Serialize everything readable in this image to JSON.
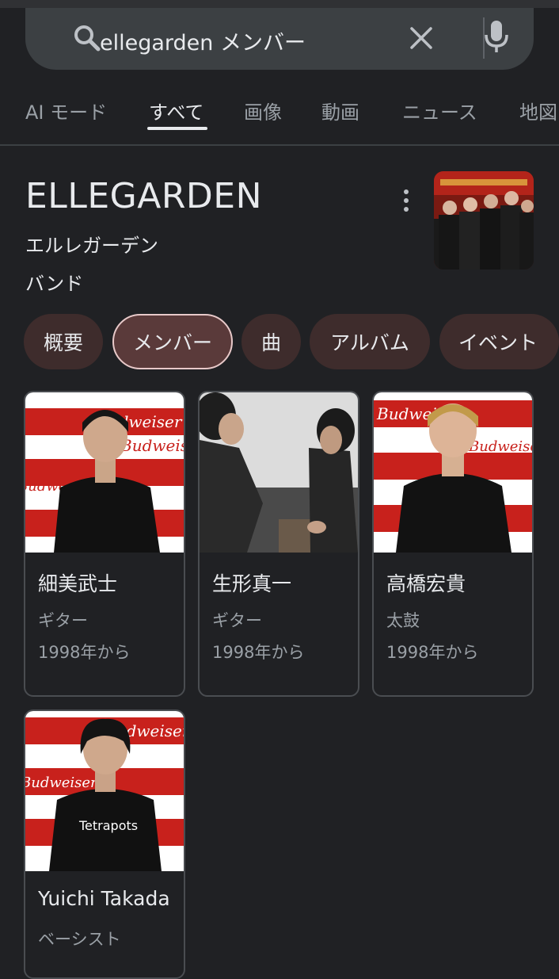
{
  "search": {
    "query": "ellegarden メンバー"
  },
  "tabs": [
    {
      "label": "AI モード"
    },
    {
      "label": "すべて"
    },
    {
      "label": "画像"
    },
    {
      "label": "動画"
    },
    {
      "label": "ニュース"
    },
    {
      "label": "地図"
    }
  ],
  "active_tab": "すべて",
  "entity": {
    "title": "ELLEGARDEN",
    "reading": "エルレガーデン",
    "type": "バンド"
  },
  "chips": [
    {
      "label": "概要"
    },
    {
      "label": "メンバー"
    },
    {
      "label": "曲"
    },
    {
      "label": "アルバム"
    },
    {
      "label": "イベント"
    }
  ],
  "selected_chip": "メンバー",
  "members": [
    {
      "name": "細美武士",
      "role": "ギター",
      "since": "1998年から"
    },
    {
      "name": "生形真一",
      "role": "ギター",
      "since": "1998年から"
    },
    {
      "name": "高橋宏貴",
      "role": "太鼓",
      "since": "1998年から"
    },
    {
      "name": "Yuichi Takada",
      "role": "ベーシスト"
    }
  ],
  "photo_logo_text": "Budweiser",
  "photo_shirt_text": "Tetrapots",
  "colors": {
    "background": "#202124",
    "search_bar": "#3c4043",
    "chip": "#3e2c2c",
    "chip_selected": "#5a3a3a",
    "text_primary": "#e8eaed",
    "text_secondary": "#9aa0a6"
  }
}
